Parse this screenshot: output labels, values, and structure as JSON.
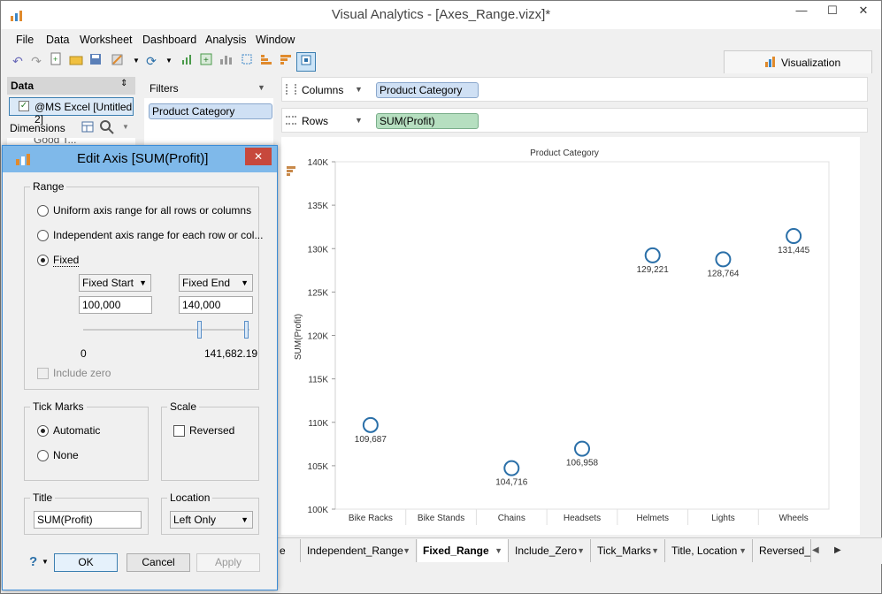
{
  "window": {
    "title": "Visual Analytics - [Axes_Range.vizx]*",
    "minimize": "—",
    "maximize": "☐",
    "close": "✕"
  },
  "menu": [
    "File",
    "Data",
    "Worksheet",
    "Dashboard",
    "Analysis",
    "Window"
  ],
  "visualization_tab": "Visualization",
  "data_pane": {
    "header": "Data",
    "source": "@MS Excel [Untitled 2]",
    "dimensions_label": "Dimensions",
    "hidden_item": "Good T..."
  },
  "filters": {
    "header": "Filters",
    "pill": "Product Category"
  },
  "shelves": {
    "columns_label": "Columns",
    "columns_pill": "Product Category",
    "rows_label": "Rows",
    "rows_pill": "SUM(Profit)"
  },
  "chart_data": {
    "type": "scatter",
    "title": "Product Category",
    "ylabel": "SUM(Profit)",
    "ylim": [
      100000,
      140000
    ],
    "y_ticks": [
      "100K",
      "105K",
      "110K",
      "115K",
      "120K",
      "125K",
      "130K",
      "135K",
      "140K"
    ],
    "categories": [
      "Bike Racks",
      "Bike Stands",
      "Chains",
      "Headsets",
      "Helmets",
      "Lights",
      "Wheels"
    ],
    "points": [
      {
        "category": "Bike Racks",
        "value": 109687,
        "label": "109,687"
      },
      {
        "category": "Chains",
        "value": 104716,
        "label": "104,716"
      },
      {
        "category": "Headsets",
        "value": 106958,
        "label": "106,958"
      },
      {
        "category": "Helmets",
        "value": 129221,
        "label": "129,221"
      },
      {
        "category": "Lights",
        "value": 128764,
        "label": "128,764"
      },
      {
        "category": "Wheels",
        "value": 131445,
        "label": "131,445"
      }
    ],
    "marker_color": "#2a6fa8"
  },
  "dialog": {
    "title": "Edit Axis [SUM(Profit)]",
    "range_group": "Range",
    "opt_uniform": "Uniform axis range for all rows or columns",
    "opt_independent": "Independent axis range for each row or col...",
    "opt_fixed": "Fixed",
    "start_mode": "Fixed Start",
    "end_mode": "Fixed End",
    "start_value": "100,000",
    "end_value": "140,000",
    "slider_min": "0",
    "slider_max": "141,682.19",
    "include_zero": "Include zero",
    "tick_group": "Tick Marks",
    "tick_automatic": "Automatic",
    "tick_none": "None",
    "scale_group": "Scale",
    "scale_reversed": "Reversed",
    "title_group": "Title",
    "title_value": "SUM(Profit)",
    "location_group": "Location",
    "location_value": "Left Only",
    "help": "?",
    "ok": "OK",
    "cancel": "Cancel",
    "apply": "Apply"
  },
  "sheet_tabs": [
    {
      "label": "e",
      "active": false
    },
    {
      "label": "Independent_Range",
      "active": false
    },
    {
      "label": "Fixed_Range",
      "active": true
    },
    {
      "label": "Include_Zero",
      "active": false
    },
    {
      "label": "Tick_Marks",
      "active": false
    },
    {
      "label": "Title, Location",
      "active": false
    },
    {
      "label": "Reversed_S",
      "active": false
    }
  ]
}
